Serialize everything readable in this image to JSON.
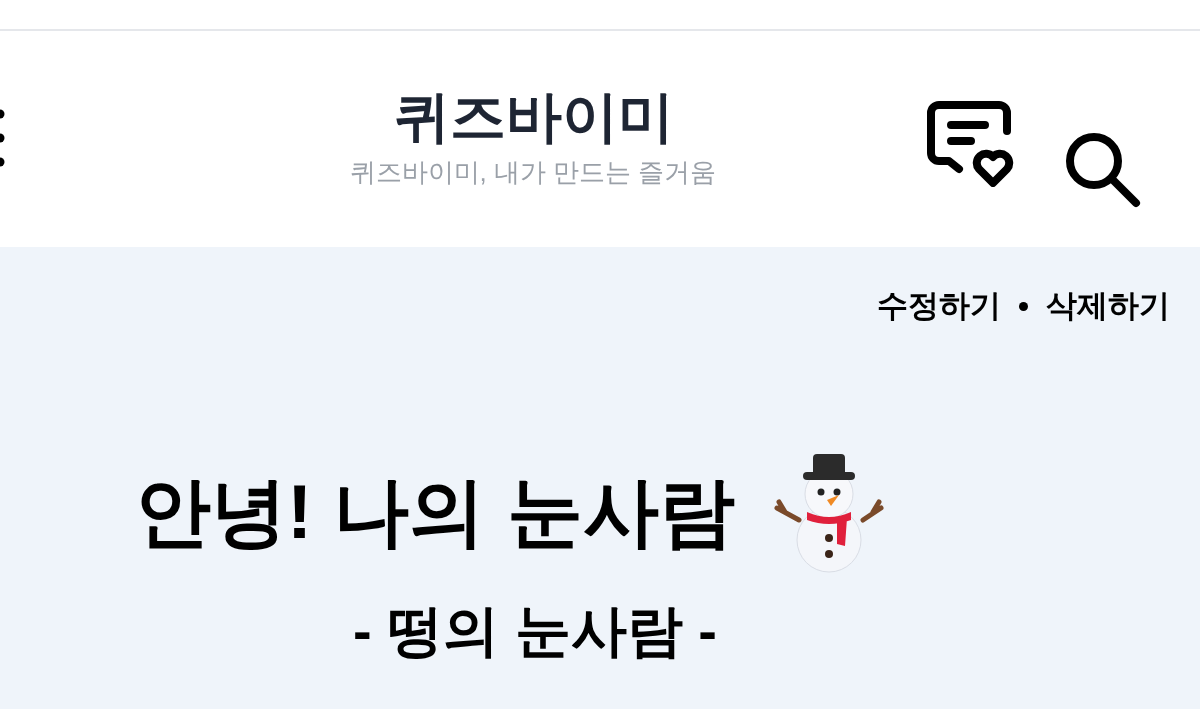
{
  "header": {
    "title": "퀴즈바이미",
    "subtitle": "퀴즈바이미, 내가 만드는 즐거움"
  },
  "actions": [
    "수정하기",
    "삭제하기"
  ],
  "post": {
    "title": "안녕! 나의 눈사람",
    "subtitle": "- 떵의 눈사람 -"
  }
}
